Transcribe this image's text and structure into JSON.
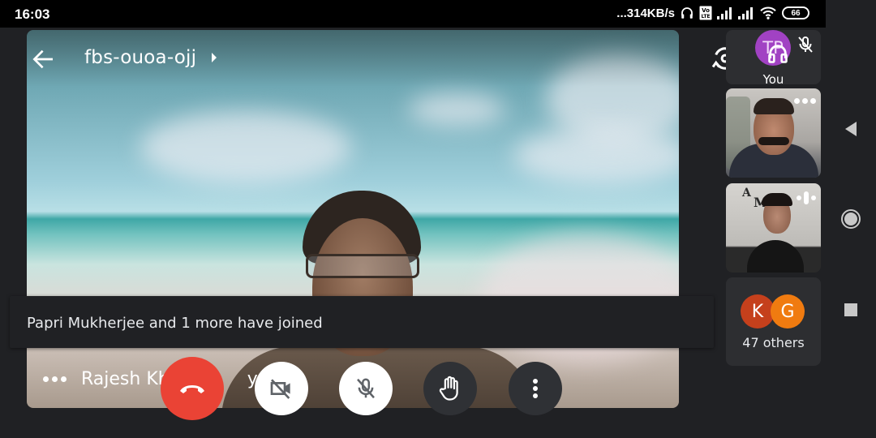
{
  "status_bar": {
    "time": "16:03",
    "network_speed": "...314KB/s",
    "icons": [
      "headphones-icon",
      "volte-icon",
      "signal-icon",
      "signal-icon",
      "wifi-icon"
    ],
    "battery": "66"
  },
  "meeting": {
    "code": "fbs-ouoa-ojj",
    "active_speaker": "Rajesh Khandelwal Khayat",
    "active_speaker_visible": "Rajesh Kh",
    "active_speaker_visible_tail": "yat"
  },
  "toast": {
    "message": "Papri Mukherjee and 1 more have joined"
  },
  "controls": {
    "end_call": "end-call",
    "camera": "camera-off",
    "mic": "mic-off",
    "raise_hand": "raise-hand",
    "more": "more-options"
  },
  "participants": {
    "self": {
      "initials": "TP",
      "label": "You",
      "avatar_color": "#a142c3",
      "muted": true
    },
    "others_count_label": "47 others",
    "others_avatars": [
      {
        "initial": "K",
        "color": "#c5401c"
      },
      {
        "initial": "G",
        "color": "#f07b10"
      }
    ]
  },
  "colors": {
    "end_call": "#ea4335",
    "background": "#202124",
    "tile": "#2d2e31"
  }
}
